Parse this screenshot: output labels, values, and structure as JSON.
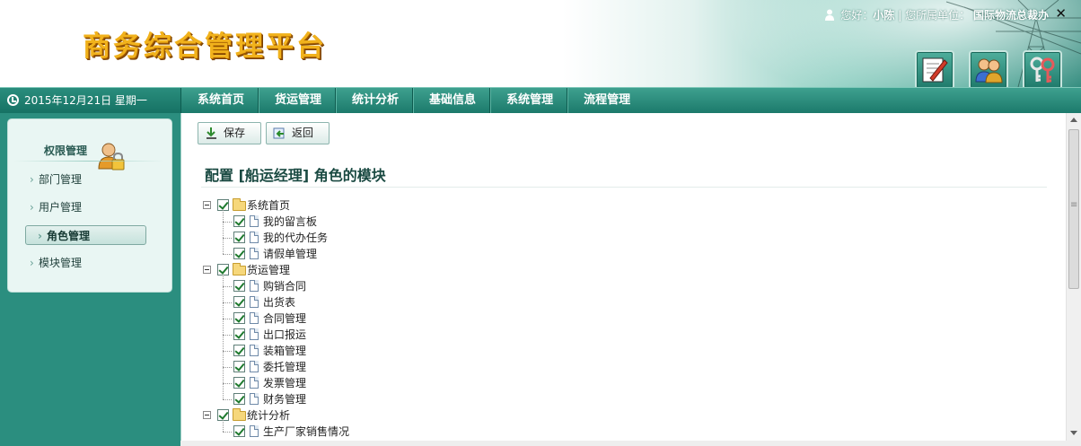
{
  "header": {
    "logo_text": "商务综合管理平台",
    "greeting": "您好：",
    "user_name": "小陈",
    "separator": "|",
    "org_label": "您所属单位：",
    "org_name": "国际物流总裁办",
    "close": "✕",
    "icons": [
      "edit-icon",
      "users-icon",
      "keys-icon"
    ]
  },
  "navbar": {
    "date": "2015年12月21日 星期一",
    "menu": [
      {
        "label": "系统首页"
      },
      {
        "label": "货运管理"
      },
      {
        "label": "统计分析"
      },
      {
        "label": "基础信息"
      },
      {
        "label": "系统管理"
      },
      {
        "label": "流程管理"
      }
    ]
  },
  "sidebar": {
    "title": "权限管理",
    "items": [
      {
        "label": "部门管理",
        "active": false
      },
      {
        "label": "用户管理",
        "active": false
      },
      {
        "label": "角色管理",
        "active": true
      },
      {
        "label": "模块管理",
        "active": false
      }
    ]
  },
  "toolbar": {
    "save_label": "保存",
    "back_label": "返回"
  },
  "main": {
    "page_title": "配置 [船运经理] 角色的模块"
  },
  "tree": [
    {
      "label": "系统首页",
      "checked": true,
      "expanded": true,
      "children": [
        {
          "label": "我的留言板",
          "checked": true
        },
        {
          "label": "我的代办任务",
          "checked": true
        },
        {
          "label": "请假单管理",
          "checked": true
        }
      ]
    },
    {
      "label": "货运管理",
      "checked": true,
      "expanded": true,
      "children": [
        {
          "label": "购销合同",
          "checked": true
        },
        {
          "label": "出货表",
          "checked": true
        },
        {
          "label": "合同管理",
          "checked": true
        },
        {
          "label": "出口报运",
          "checked": true
        },
        {
          "label": "装箱管理",
          "checked": true
        },
        {
          "label": "委托管理",
          "checked": true
        },
        {
          "label": "发票管理",
          "checked": true
        },
        {
          "label": "财务管理",
          "checked": true
        }
      ]
    },
    {
      "label": "统计分析",
      "checked": true,
      "expanded": true,
      "children": [
        {
          "label": "生产厂家销售情况",
          "checked": true
        }
      ]
    }
  ],
  "colors": {
    "accent": "#2b8e7f",
    "nav": "#1c7a6b",
    "logo": "#f1b21c"
  }
}
